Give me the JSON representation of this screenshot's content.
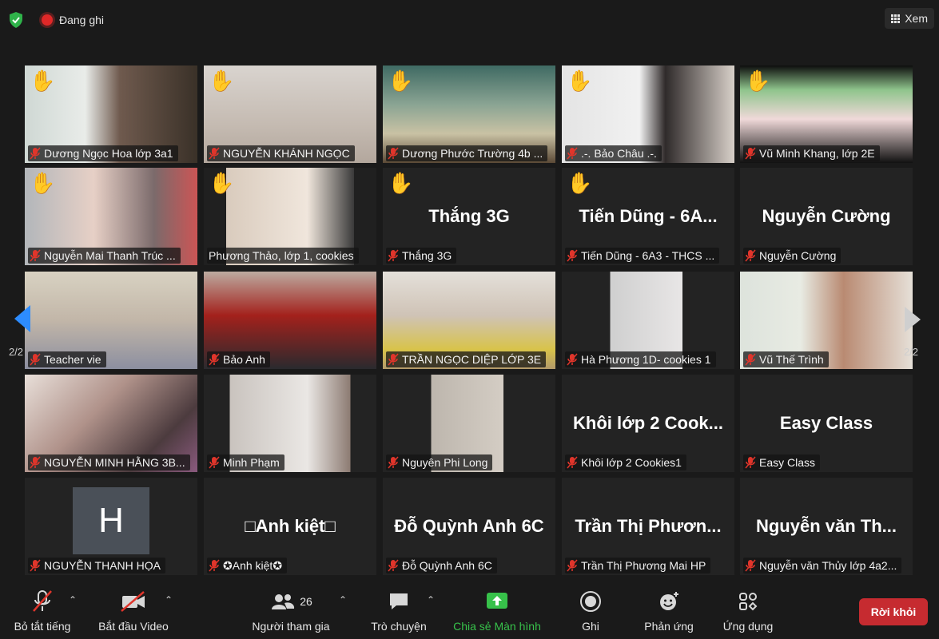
{
  "top": {
    "recording": "Đang ghi",
    "view": "Xem"
  },
  "pager": {
    "left": "2/2",
    "right": "2/2"
  },
  "tiles": [
    {
      "name": "Dương Ngọc Hoa lớp 3a1",
      "hand": "✋"
    },
    {
      "name": "NGUYỄN KHÁNH NGỌC",
      "hand": "✋"
    },
    {
      "name": "Dương Phước Trường 4b ...",
      "hand": "✋"
    },
    {
      "name": ".-. Bảo Châu .-.",
      "hand": "✋"
    },
    {
      "name": "Vũ Minh Khang, lớp 2E",
      "hand": "✋"
    },
    {
      "name": "Nguyễn Mai Thanh Trúc ...",
      "hand": "✋"
    },
    {
      "name": "Phương Thảo, lớp 1, cookies",
      "hand": "✋"
    },
    {
      "name": "Thắng 3G",
      "hand": "✋",
      "big": "Thắng 3G"
    },
    {
      "name": "Tiến Dũng - 6A3 - THCS ...",
      "hand": "✋",
      "big": "Tiến Dũng - 6A..."
    },
    {
      "name": "Nguyễn Cường",
      "big": "Nguyễn Cường"
    },
    {
      "name": "Teacher vie"
    },
    {
      "name": "Bảo Anh"
    },
    {
      "name": "TRẦN NGỌC DIỆP LỚP 3E"
    },
    {
      "name": "Hà Phương 1D- cookies 1"
    },
    {
      "name": "Vũ Thế Trình"
    },
    {
      "name": "NGUYỄN MINH HẰNG 3B..."
    },
    {
      "name": "Minh Phạm"
    },
    {
      "name": "Nguyên Phi Long"
    },
    {
      "name": "Khôi lớp 2 Cookies1",
      "big": "Khôi lớp 2 Cook..."
    },
    {
      "name": "Easy Class",
      "big": "Easy Class"
    },
    {
      "name": "NGUYỄN THANH HỌA",
      "avatar": "H"
    },
    {
      "name": "✪Anh kiệt✪",
      "big": "□Anh kiệt□"
    },
    {
      "name": "Đỗ Quỳnh Anh 6C",
      "big": "Đỗ Quỳnh Anh 6C"
    },
    {
      "name": "Trần Thị Phương Mai HP",
      "big": "Trần Thị Phươn..."
    },
    {
      "name": "Nguyễn văn Thủy lớp 4a2...",
      "big": "Nguyễn văn Th..."
    }
  ],
  "toolbar": {
    "mute": "Bỏ tắt tiếng",
    "video": "Bắt đầu Video",
    "participants": "Người tham gia",
    "participants_count": "26",
    "chat": "Trò chuyện",
    "share": "Chia sẻ Màn hình",
    "record": "Ghi",
    "reactions": "Phản ứng",
    "apps": "Ứng dụng",
    "leave": "Rời khỏi"
  },
  "colors": {
    "share": "#37c14a",
    "leave": "#c62b30",
    "active_border": "#b9e35a",
    "hand": "#f5b63a",
    "pager_active": "#2d8cff"
  }
}
